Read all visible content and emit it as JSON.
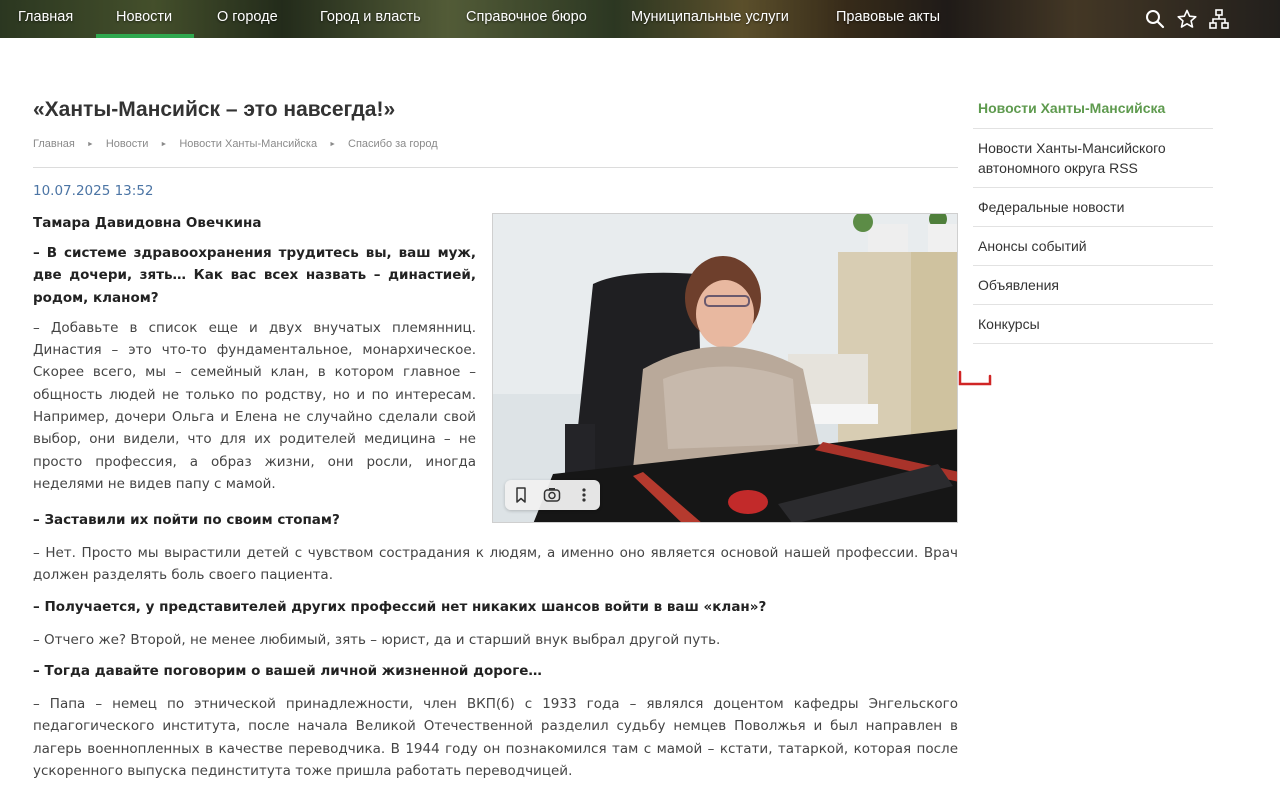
{
  "nav": {
    "items": [
      "Главная",
      "Новости",
      "О городе",
      "Город и власть",
      "Справочное бюро",
      "Муниципальные услуги",
      "Правовые акты"
    ],
    "active_index": 1,
    "icons": [
      "search-icon",
      "star-icon",
      "sitemap-icon"
    ]
  },
  "article": {
    "title": "«Ханты-Мансийск – это навсегда!»",
    "breadcrumb": [
      "Главная",
      "Новости",
      "Новости Ханты-Мансийска",
      "Спасибо за город"
    ],
    "date": "10.07.2025 13:52",
    "author": "Тамара Давидовна Овечкина",
    "q1": "– В системе здравоохранения трудитесь вы, ваш муж, две дочери, зять… Как вас всех назвать – династией, родом, кланом?",
    "a1": "– Добавьте в список еще и двух внучатых племянниц. Династия – это что-то фундаментальное, монархическое. Скорее всего, мы – семейный клан, в котором главное – общность людей не только по родству, но и по интересам. Например, дочери Ольга и Елена не случайно сделали свой выбор, они видели, что для их родителей медицина – не просто профессия, а образ жизни, они росли, иногда неделями не видев папу с мамой.",
    "q2": "– Заставили их пойти по своим стопам?",
    "a2": "– Нет. Просто мы вырастили детей с чувством сострадания к людям, а именно оно является основой нашей профессии. Врач должен разделять боль своего пациента.",
    "q3": "– Получается, у представителей других профессий нет никаких шансов войти в ваш «клан»?",
    "a3": "– Отчего же? Второй, не менее любимый, зять – юрист, да и старший внук выбрал другой путь.",
    "q4": "– Тогда давайте поговорим о вашей личной жизненной дороге…",
    "a4": "– Папа – немец по этнической принадлежности, член ВКП(б) с 1933 года – являлся доцентом кафедры Энгельского педагогического института, после начала Великой Отечественной разделил судьбу немцев Поволжья и был направлен в лагерь военнопленных в качестве переводчика. В 1944 году он познакомился там с мамой – кстати, татаркой, которая после ускоренного выпуска пединститута тоже пришла работать переводчицей."
  },
  "photo_toolbar": {
    "icons": [
      "bookmark-icon",
      "lens-icon",
      "more-vertical-icon"
    ]
  },
  "sidebar": {
    "items": [
      "Новости Ханты-Мансийска",
      "Новости Ханты-Мансийского автономного округа RSS",
      "Федеральные новости",
      "Анонсы событий",
      "Объявления",
      "Конкурсы"
    ],
    "active_index": 0
  },
  "colors": {
    "accent_green": "#2fa84f",
    "sidebar_active": "#5e9a4e",
    "date_blue": "#4c75a5"
  }
}
